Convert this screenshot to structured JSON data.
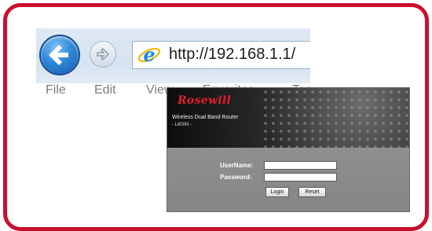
{
  "browser": {
    "url": "http://192.168.1.1/",
    "menu": [
      "File",
      "Edit",
      "View",
      "Favorites",
      "Tools"
    ]
  },
  "router": {
    "logo": "Rosewill",
    "title": "Wireless Dual Band Router",
    "model": "- L600N -",
    "username_label": "UserName:",
    "password_label": "Password:",
    "username_value": "",
    "password_value": "",
    "login_button": "Login",
    "reset_button": "Reset"
  },
  "colors": {
    "frame_border": "#c8102e",
    "logo_red": "#e0202a",
    "ie_blue": "#1e88e5",
    "back_button_blue": "#2f88d8"
  },
  "icons": [
    "back-arrow-icon",
    "forward-arrow-icon",
    "ie-icon"
  ]
}
